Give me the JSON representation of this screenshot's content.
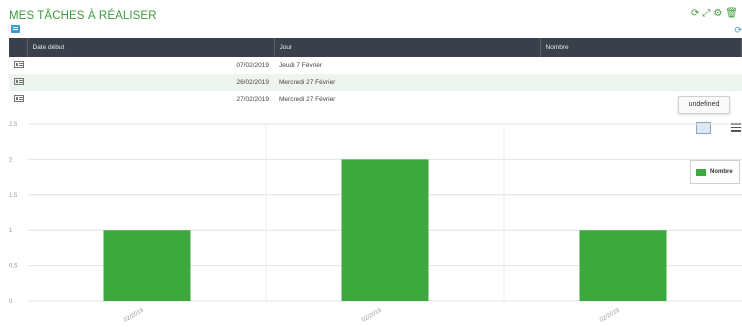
{
  "header": {
    "title": "MES TÂCHES À RÉALISER",
    "tool_icons": [
      "refresh-icon",
      "expand-icon",
      "gear-icon",
      "trash-icon"
    ]
  },
  "table": {
    "columns": [
      "Date début",
      "Jour",
      "Nombre"
    ],
    "rows": [
      {
        "date": "07/02/2019",
        "jour": "Jeudi 7 Février",
        "nombre": ""
      },
      {
        "date": "26/02/2019",
        "jour": "Mercredi 27 Février",
        "nombre": ""
      },
      {
        "date": "27/02/2019",
        "jour": "Mercredi 27 Février",
        "nombre": ""
      }
    ]
  },
  "tooltip": "undefined",
  "colors": {
    "accent": "#3e9b3e",
    "bar": "#3da83d",
    "table_header": "#3a3f4c"
  },
  "chart_data": {
    "type": "bar",
    "categories": [
      "07/02/2019",
      "26/02/2019",
      "27/02/2019"
    ],
    "series": [
      {
        "name": "Nombre",
        "values": [
          1,
          2,
          1
        ]
      }
    ],
    "ylim": [
      0,
      2.5
    ],
    "yticks": [
      "0",
      "0.5",
      "1",
      "1.5",
      "2",
      "2.5"
    ],
    "xtick_display": [
      "02/2019",
      "02/2019",
      "02/2019"
    ],
    "grid": true,
    "legend": "right"
  }
}
